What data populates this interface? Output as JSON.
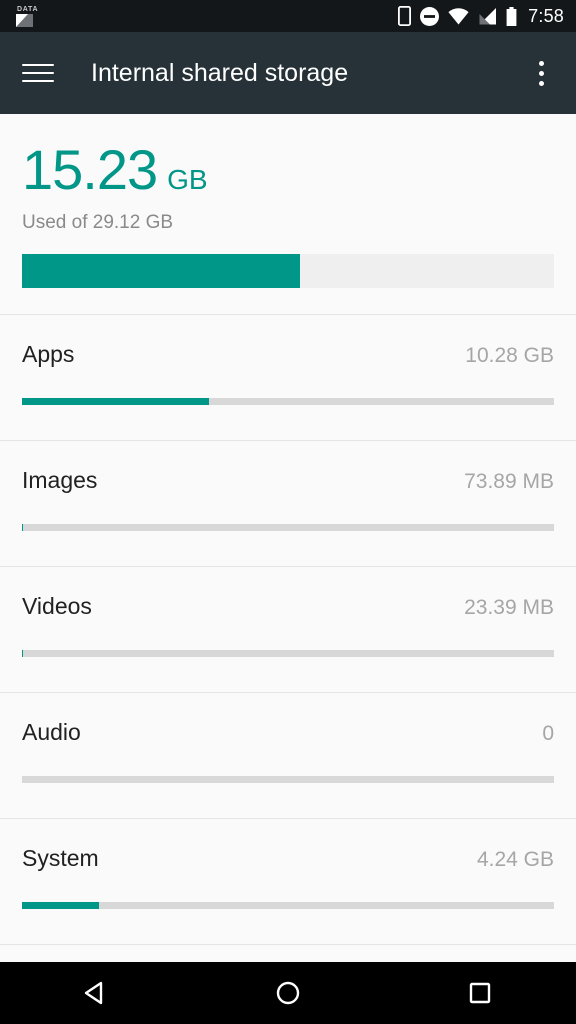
{
  "status_bar": {
    "data_label": "DATA",
    "data_icon": "data-usage-icon",
    "icons": [
      {
        "name": "vibrate-icon"
      },
      {
        "name": "do-not-disturb-icon"
      },
      {
        "name": "wifi-icon"
      },
      {
        "name": "cell-signal-icon"
      },
      {
        "name": "battery-icon"
      }
    ],
    "time": "7:58"
  },
  "app_bar": {
    "menu_icon": "hamburger-menu-icon",
    "title": "Internal shared storage",
    "overflow_icon": "more-vert-icon"
  },
  "summary": {
    "used_value": "15.23",
    "used_unit": "GB",
    "subtitle": "Used of 29.12 GB",
    "fill_percent": 52.3,
    "fill_color": "#009688",
    "track_color": "#efefef"
  },
  "categories": [
    {
      "label": "Apps",
      "value": "10.28 GB",
      "fill_percent": 35.2
    },
    {
      "label": "Images",
      "value": "73.89 MB",
      "fill_percent": 0.25
    },
    {
      "label": "Videos",
      "value": "23.39 MB",
      "fill_percent": 0.08
    },
    {
      "label": "Audio",
      "value": "0",
      "fill_percent": 0
    },
    {
      "label": "System",
      "value": "4.24 GB",
      "fill_percent": 14.5
    }
  ],
  "nav_bar": {
    "back_label": "back-button",
    "home_label": "home-button",
    "recents_label": "recents-button"
  }
}
